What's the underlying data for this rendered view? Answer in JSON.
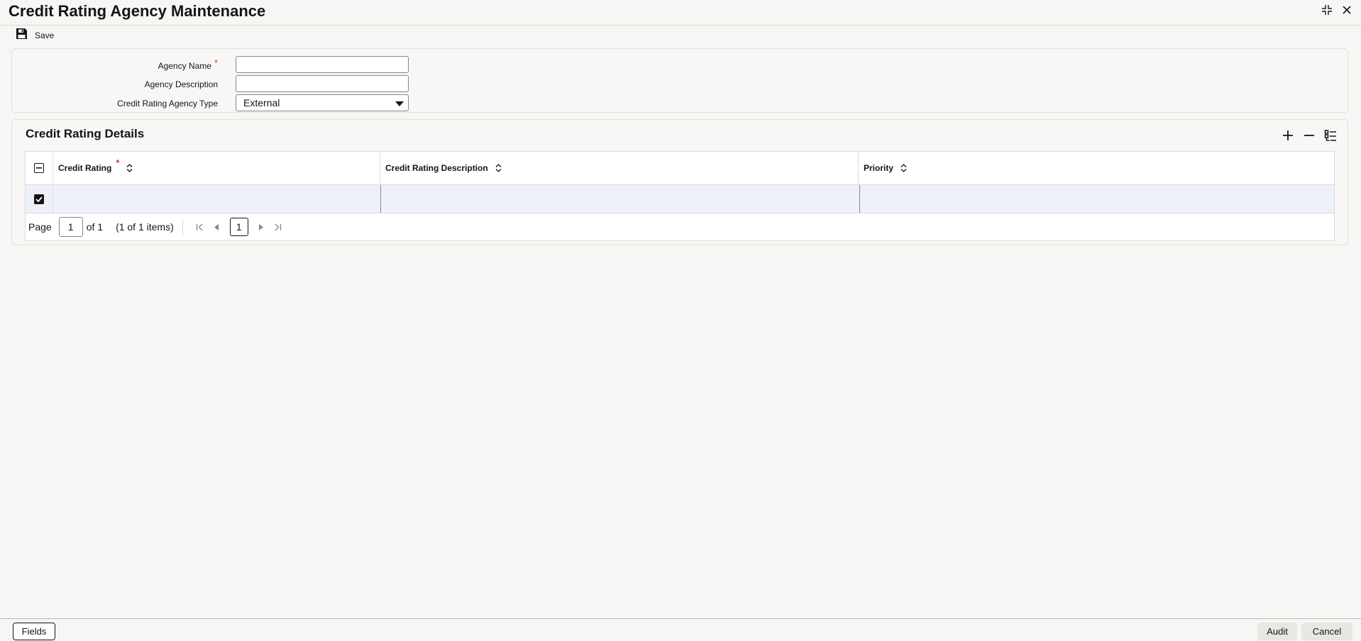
{
  "window": {
    "title": "Credit Rating Agency Maintenance",
    "controls": [
      {
        "icon": "collapse-icon"
      },
      {
        "icon": "close-icon"
      }
    ]
  },
  "toolbar": {
    "save_label": "Save",
    "save_icon": "floppy-disk-icon"
  },
  "form": {
    "agency_name": {
      "label": "Agency Name",
      "required_mark": "*",
      "value": ""
    },
    "agency_description": {
      "label": "Agency Description",
      "value": ""
    },
    "agency_type": {
      "label": "Credit Rating Agency Type",
      "value": "External"
    }
  },
  "details": {
    "title": "Credit Rating Details",
    "actions": [
      "add-row-icon",
      "delete-row-icon",
      "single-record-view-icon"
    ],
    "columns": [
      {
        "label": "Credit Rating",
        "required_mark": "*"
      },
      {
        "label": "Credit Rating Description"
      },
      {
        "label": "Priority"
      }
    ],
    "rows": [
      {
        "selected": true,
        "credit_rating": "",
        "description": "",
        "priority": ""
      }
    ],
    "pager": {
      "page_label": "Page",
      "page_value": "1",
      "of_label": "of 1",
      "items_label": "(1 of 1 items)",
      "current_page": "1"
    }
  },
  "footer": {
    "fields_label": "Fields",
    "audit_label": "Audit",
    "cancel_label": "Cancel"
  },
  "colors": {
    "required": "#c74634",
    "row_highlight": "#eef1fa",
    "text": "#161513"
  }
}
